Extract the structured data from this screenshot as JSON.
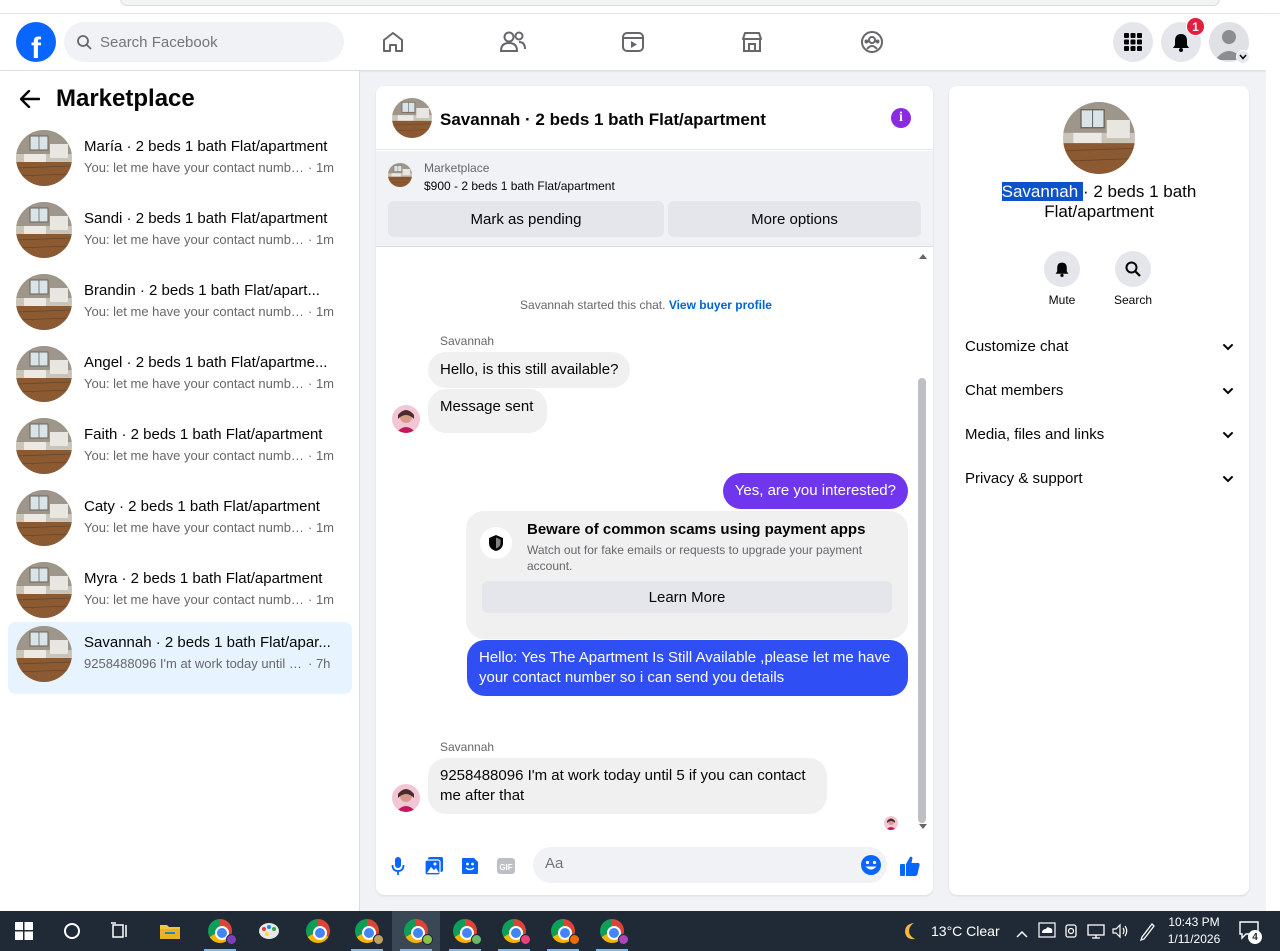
{
  "topnav": {
    "logo_letter": "f",
    "search_placeholder": "Search Facebook",
    "notifications_count": "1",
    "icons": [
      "home-icon",
      "friends-icon",
      "video-icon",
      "marketplace-icon",
      "groups-icon",
      "menu-grid-icon",
      "bell-icon",
      "profile-avatar"
    ]
  },
  "sidebar": {
    "title": "Marketplace",
    "conversations": [
      {
        "title": "María · 2 beds 1 bath Flat/apartment",
        "preview": "You: let me have your contact numbe...",
        "time": "· 1m"
      },
      {
        "title": "Sandi · 2 beds 1 bath Flat/apartment",
        "preview": "You: let me have your contact numbe...",
        "time": "· 1m"
      },
      {
        "title": "Brandin · 2 beds 1 bath Flat/apart...",
        "preview": "You: let me have your contact numbe...",
        "time": "· 1m"
      },
      {
        "title": "Angel · 2 beds 1 bath Flat/apartme...",
        "preview": "You: let me have your contact numbe...",
        "time": "· 1m"
      },
      {
        "title": "Faith · 2 beds 1 bath Flat/apartment",
        "preview": "You: let me have your contact numbe...",
        "time": "· 1m"
      },
      {
        "title": "Caty · 2 beds 1 bath Flat/apartment",
        "preview": "You: let me have your contact numbe...",
        "time": "· 1m"
      },
      {
        "title": "Myra · 2 beds 1 bath Flat/apartment",
        "preview": "You: let me have your contact numbe...",
        "time": "· 1m"
      },
      {
        "title": "Savannah · 2 beds 1 bath Flat/apar...",
        "preview": "9258488096 I'm at work today until 5 ...",
        "time": "· 7h"
      }
    ]
  },
  "chat": {
    "title": "Savannah · 2 beds 1 bath Flat/apartment",
    "info_icon": "i",
    "listing": {
      "label": "Marketplace",
      "price_line": "$900 - 2 beds 1 bath Flat/apartment",
      "pending_button": "Mark as pending",
      "more_button": "More options"
    },
    "system_text": "Savannah started this chat.",
    "system_link": "View buyer profile",
    "messages": {
      "sender_1": "Savannah",
      "in_1": "Hello, is this still available?",
      "in_2": "Message sent",
      "out_1": "Yes, are you interested?",
      "scam_title": "Beware of common scams using payment apps",
      "scam_desc": "Watch out for fake emails or requests to upgrade your payment account.",
      "scam_button": "Learn More",
      "out_2": "Hello: Yes The Apartment Is Still Available ,please let me have your contact number so i can send you details",
      "sender_2": "Savannah",
      "in_3": "9258488096 I'm at work today until 5 if you can contact me after that"
    },
    "composer_placeholder": "Aa"
  },
  "right_panel": {
    "title_highlight": "Savannah ",
    "title_rest": "· 2 beds 1 bath Flat/apartment",
    "actions": [
      {
        "label": "Mute",
        "icon": "bell-icon"
      },
      {
        "label": "Search",
        "icon": "search-icon"
      }
    ],
    "sections": [
      "Customize chat",
      "Chat members",
      "Media, files and links",
      "Privacy & support"
    ]
  },
  "taskbar": {
    "weather": "13°C  Clear",
    "time": "10:43 PM",
    "date": "1/11/2026",
    "notification_count": "4"
  },
  "colors": {
    "facebook_blue": "#0866ff",
    "outgoing_purple": "#6f36ee",
    "outgoing_blue": "#2f4ff5",
    "info_purple": "#8a2be2",
    "highlight": "#0c53c9"
  }
}
